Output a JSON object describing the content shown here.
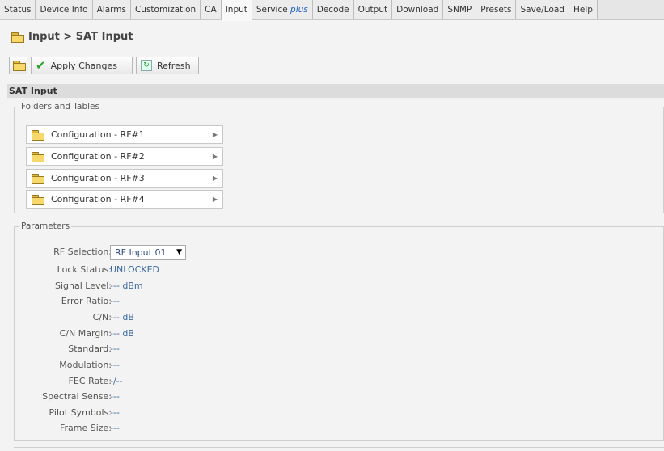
{
  "tabs": [
    {
      "label": "Status"
    },
    {
      "label": "Device Info"
    },
    {
      "label": "Alarms"
    },
    {
      "label": "Customization"
    },
    {
      "label": "CA"
    },
    {
      "label": "Input"
    },
    {
      "label": "Service ",
      "plus": "plus"
    },
    {
      "label": "Decode"
    },
    {
      "label": "Output"
    },
    {
      "label": "Download"
    },
    {
      "label": "SNMP"
    },
    {
      "label": "Presets"
    },
    {
      "label": "Save/Load"
    },
    {
      "label": "Help"
    }
  ],
  "page": {
    "title": "Input > SAT Input"
  },
  "toolbar": {
    "apply_label": "Apply Changes",
    "refresh_label": "Refresh"
  },
  "section": {
    "title": "SAT Input"
  },
  "folders": {
    "legend": "Folders and Tables",
    "items": [
      {
        "label": "Configuration - RF#1"
      },
      {
        "label": "Configuration - RF#2"
      },
      {
        "label": "Configuration - RF#3"
      },
      {
        "label": "Configuration - RF#4"
      }
    ]
  },
  "parameters": {
    "legend": "Parameters",
    "rf_selection": {
      "label": "RF Selection:",
      "value": "RF Input 01"
    },
    "rows": [
      {
        "label": "Lock Status:",
        "value": "UNLOCKED"
      },
      {
        "label": "Signal Level:",
        "value": "--- dBm"
      },
      {
        "label": "Error Ratio:",
        "value": "---"
      },
      {
        "label": "C/N:",
        "value": "--- dB"
      },
      {
        "label": "C/N Margin:",
        "value": "--- dB"
      },
      {
        "label": "Standard:",
        "value": "---"
      },
      {
        "label": "Modulation:",
        "value": "---"
      },
      {
        "label": "FEC Rate:",
        "value": "-/--"
      },
      {
        "label": "Spectral Sense:",
        "value": "---"
      },
      {
        "label": "Pilot Symbols:",
        "value": "---"
      },
      {
        "label": "Frame Size:",
        "value": "---"
      }
    ]
  },
  "colors": {
    "value_blue": "#3b6aa0",
    "accent_plus": "#2060c0"
  }
}
